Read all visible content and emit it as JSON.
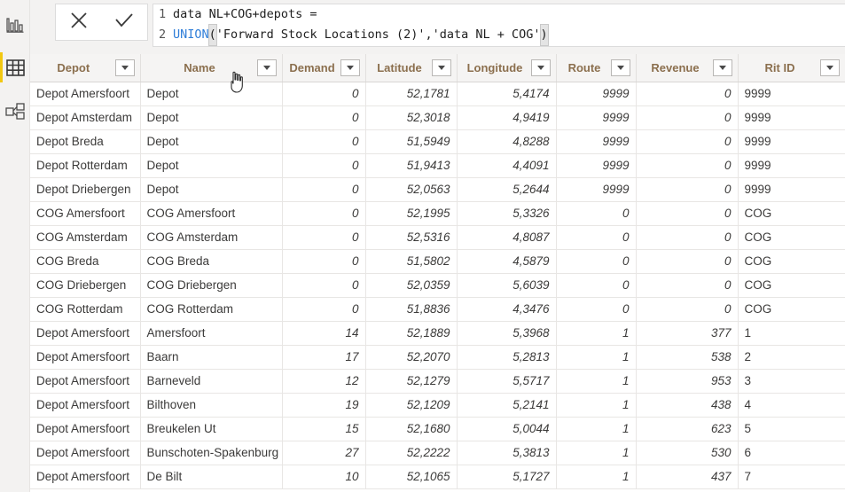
{
  "app": {
    "accent_yellow": "#f2c811",
    "header_text_color": "#8b6f4e",
    "keyword_color": "#2f7ed8"
  },
  "nav_rail": {
    "items": [
      {
        "name": "report-view",
        "icon": "bar-chart-icon",
        "label": "Report",
        "selected": false
      },
      {
        "name": "data-view",
        "icon": "table-icon",
        "label": "Data",
        "selected": true
      },
      {
        "name": "model-view",
        "icon": "model-relationship-icon",
        "label": "Model",
        "selected": false
      }
    ]
  },
  "formula_bar": {
    "cancel_label": "✕",
    "cancel_name": "cancel-edit-icon",
    "commit_label": "✓",
    "commit_name": "commit-edit-icon",
    "lines": [
      {
        "number": "1",
        "text": "data NL+COG+depots ="
      },
      {
        "number": "2",
        "prefix": "",
        "fn": "UNION",
        "open_paren": "(",
        "body": "'Forward Stock Locations (2)','data NL + COG'",
        "close_paren": ")"
      }
    ]
  },
  "grid": {
    "columns": [
      {
        "label": "Depot",
        "align": "left"
      },
      {
        "label": "Name",
        "align": "left"
      },
      {
        "label": "Demand",
        "align": "right"
      },
      {
        "label": "Latitude",
        "align": "right"
      },
      {
        "label": "Longitude",
        "align": "right"
      },
      {
        "label": "Route",
        "align": "right"
      },
      {
        "label": "Revenue",
        "align": "right"
      },
      {
        "label": "Rit ID",
        "align": "left"
      }
    ],
    "rows": [
      [
        "Depot Amersfoort",
        "Depot",
        "0",
        "52,1781",
        "5,4174",
        "9999",
        "0",
        "9999"
      ],
      [
        "Depot Amsterdam",
        "Depot",
        "0",
        "52,3018",
        "4,9419",
        "9999",
        "0",
        "9999"
      ],
      [
        "Depot Breda",
        "Depot",
        "0",
        "51,5949",
        "4,8288",
        "9999",
        "0",
        "9999"
      ],
      [
        "Depot Rotterdam",
        "Depot",
        "0",
        "51,9413",
        "4,4091",
        "9999",
        "0",
        "9999"
      ],
      [
        "Depot Driebergen",
        "Depot",
        "0",
        "52,0563",
        "5,2644",
        "9999",
        "0",
        "9999"
      ],
      [
        "COG Amersfoort",
        "COG Amersfoort",
        "0",
        "52,1995",
        "5,3326",
        "0",
        "0",
        "COG"
      ],
      [
        "COG Amsterdam",
        "COG Amsterdam",
        "0",
        "52,5316",
        "4,8087",
        "0",
        "0",
        "COG"
      ],
      [
        "COG Breda",
        "COG Breda",
        "0",
        "51,5802",
        "4,5879",
        "0",
        "0",
        "COG"
      ],
      [
        "COG Driebergen",
        "COG Driebergen",
        "0",
        "52,0359",
        "5,6039",
        "0",
        "0",
        "COG"
      ],
      [
        "COG Rotterdam",
        "COG Rotterdam",
        "0",
        "51,8836",
        "4,3476",
        "0",
        "0",
        "COG"
      ],
      [
        "Depot Amersfoort",
        "Amersfoort",
        "14",
        "52,1889",
        "5,3968",
        "1",
        "377",
        "1"
      ],
      [
        "Depot Amersfoort",
        "Baarn",
        "17",
        "52,2070",
        "5,2813",
        "1",
        "538",
        "2"
      ],
      [
        "Depot Amersfoort",
        "Barneveld",
        "12",
        "52,1279",
        "5,5717",
        "1",
        "953",
        "3"
      ],
      [
        "Depot Amersfoort",
        "Bilthoven",
        "19",
        "52,1209",
        "5,2141",
        "1",
        "438",
        "4"
      ],
      [
        "Depot Amersfoort",
        "Breukelen Ut",
        "15",
        "52,1680",
        "5,0044",
        "1",
        "623",
        "5"
      ],
      [
        "Depot Amersfoort",
        "Bunschoten-Spakenburg",
        "27",
        "52,2222",
        "5,3813",
        "1",
        "530",
        "6"
      ],
      [
        "Depot Amersfoort",
        "De Bilt",
        "10",
        "52,1065",
        "5,1727",
        "1",
        "437",
        "7"
      ]
    ]
  },
  "cursor": {
    "name": "hand-pointer-cursor",
    "over_column": "Name"
  }
}
